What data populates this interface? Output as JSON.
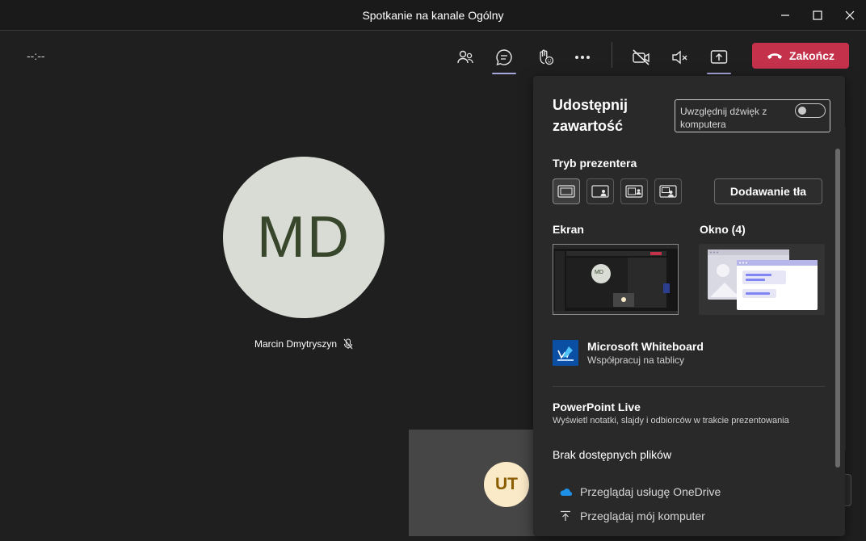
{
  "window": {
    "title": "Spotkanie na kanale Ogólny"
  },
  "toolbar": {
    "timer": "--:--",
    "end_button": "Zakończ"
  },
  "stage": {
    "main_participant": {
      "initials": "MD",
      "name": "Marcin Dmytryszyn"
    },
    "self_view": {
      "initials": "UT"
    }
  },
  "share_panel": {
    "title": "Udostępnij zawartość",
    "include_audio_label": "Uwzględnij dźwięk z komputera",
    "include_audio_on": false,
    "presenter_mode_label": "Tryb prezentera",
    "presenter_modes": [
      "content-only",
      "standout",
      "side-by-side",
      "reporter"
    ],
    "selected_mode": "content-only",
    "add_background_label": "Dodawanie tła",
    "screen_label": "Ekran",
    "window_label": "Okno (4)",
    "screen_thumb_initials": "MD",
    "whiteboard": {
      "name": "Microsoft Whiteboard",
      "subtitle": "Współpracuj na tablicy"
    },
    "powerpoint": {
      "title": "PowerPoint Live",
      "subtitle": "Wyświetl notatki, slajdy i odbiorców w trakcie prezentowania"
    },
    "no_files": "Brak dostępnych plików",
    "browse_onedrive": "Przeglądaj usługę OneDrive",
    "browse_computer": "Przeglądaj mój komputer"
  },
  "colors": {
    "end_button": "#c4314b",
    "active_underline": "#a6a7dc",
    "big_avatar_bg": "#d9dcd5",
    "big_avatar_text": "#38472b",
    "small_avatar_bg": "#fbeac8",
    "small_avatar_text": "#8a5d00",
    "panel_bg": "#292929"
  }
}
